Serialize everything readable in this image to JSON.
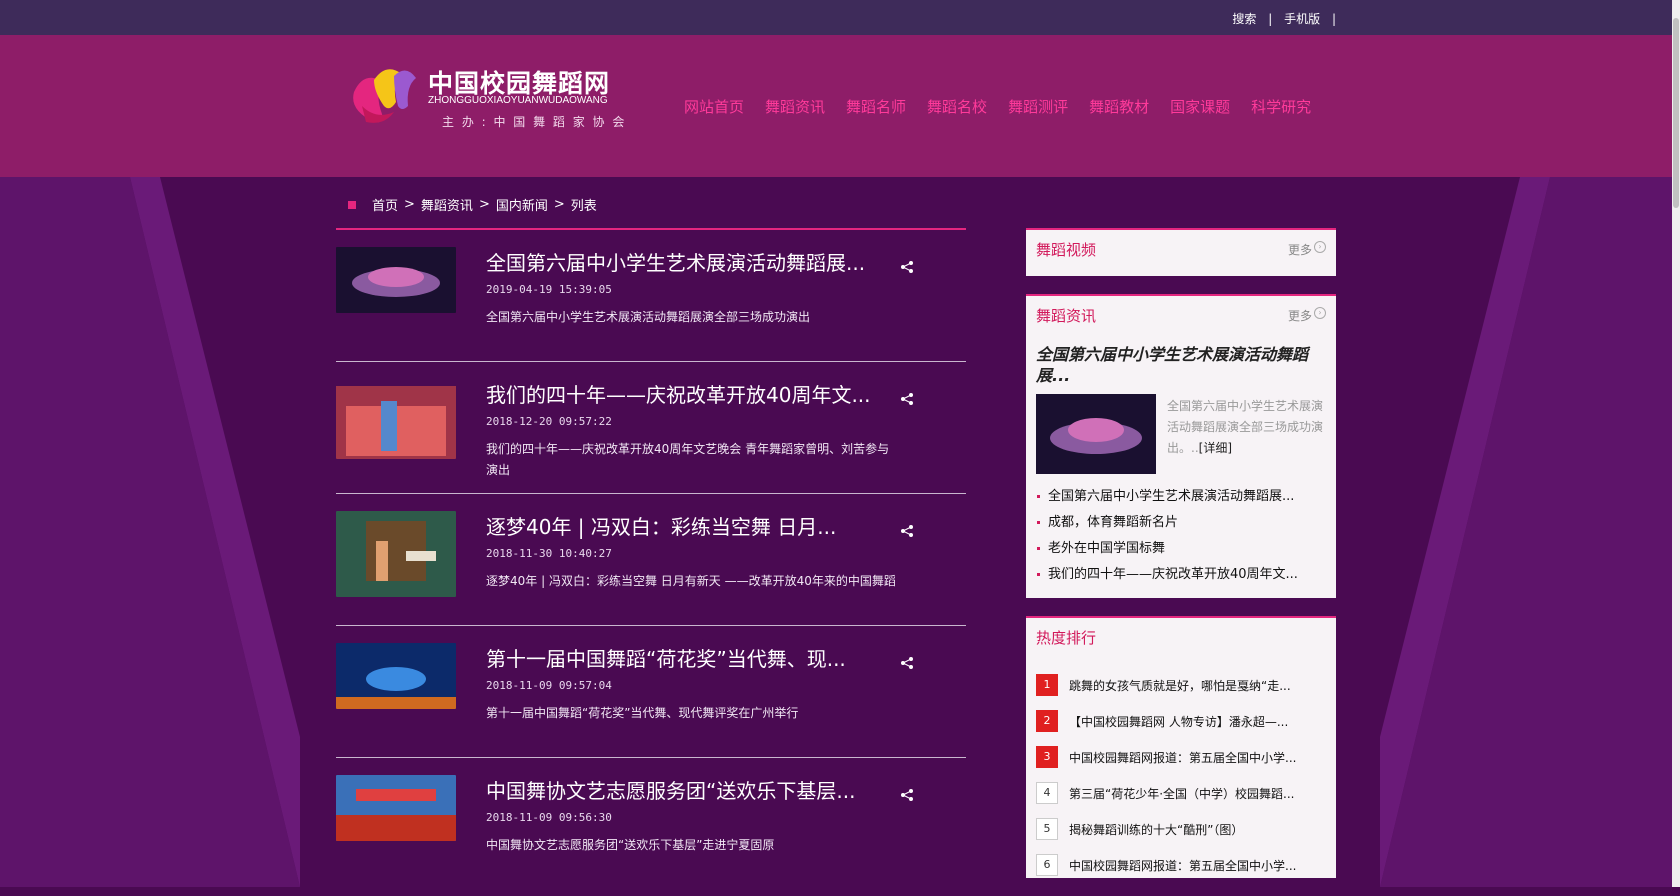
{
  "topbar": {
    "search": "搜索",
    "mobile": "手机版",
    "divider": "|"
  },
  "logo": {
    "title": "中国校园舞蹈网",
    "pinyin": "ZHONGGUOXIAOYUANWUDAOWANG",
    "host": "主 办 : 中 国 舞 蹈 家 协 会"
  },
  "nav": [
    "网站首页",
    "舞蹈资讯",
    "舞蹈名师",
    "舞蹈名校",
    "舞蹈测评",
    "舞蹈教材",
    "国家课题",
    "科学研究"
  ],
  "breadcrumb": {
    "home": "首页",
    "c1": "舞蹈资讯",
    "c2": "国内新闻",
    "c3": "列表",
    "sep": ">"
  },
  "articles": [
    {
      "title": "全国第六届中小学生艺术展演活动舞蹈展...",
      "date": "2019-04-19 15:39:05",
      "desc": "全国第六届中小学生艺术展演活动舞蹈展演全部三场成功演出",
      "thumb_color": "#1a1030"
    },
    {
      "title": "我们的四十年——庆祝改革开放40周年文...",
      "date": "2018-12-20 09:57:22",
      "desc": "我们的四十年——庆祝改革开放40周年文艺晚会 青年舞蹈家曾明、刘苦参与演出",
      "thumb_color": "#a03448"
    },
    {
      "title": "逐梦40年 | 冯双白：彩练当空舞 日月...",
      "date": "2018-11-30 10:40:27",
      "desc": "逐梦40年 | 冯双白：彩练当空舞 日月有新天 ——改革开放40年来的中国舞蹈",
      "thumb_color": "#2e5a4a"
    },
    {
      "title": "第十一届中国舞蹈“荷花奖”当代舞、现...",
      "date": "2018-11-09 09:57:04",
      "desc": "第十一届中国舞蹈“荷花奖”当代舞、现代舞评奖在广州举行",
      "thumb_color": "#0c2a6a"
    },
    {
      "title": "中国舞协文艺志愿服务团“送欢乐下基层...",
      "date": "2018-11-09 09:56:30",
      "desc": "中国舞协文艺志愿服务团“送欢乐下基层”走进宁夏固原",
      "thumb_color": "#3a70b8"
    }
  ],
  "sidebar": {
    "video_panel": {
      "title": "舞蹈视频",
      "more": "更多"
    },
    "news_panel": {
      "title": "舞蹈资讯",
      "more": "更多",
      "featured_title": "全国第六届中小学生艺术展演活动舞蹈展...",
      "featured_desc": "全国第六届中小学生艺术展演活动舞蹈展演全部三场成功演出。..",
      "featured_detail": "[详细]",
      "items": [
        "全国第六届中小学生艺术展演活动舞蹈展...",
        "成都，体育舞蹈新名片",
        "老外在中国学国标舞",
        "我们的四十年——庆祝改革开放40周年文..."
      ]
    },
    "rank_panel": {
      "title": "热度排行",
      "items": [
        {
          "n": "1",
          "text": "跳舞的女孩气质就是好，哪怕是戛纳“走..."
        },
        {
          "n": "2",
          "text": "【中国校园舞蹈网 人物专访】潘永超—..."
        },
        {
          "n": "3",
          "text": "中国校园舞蹈网报道：第五届全国中小学..."
        },
        {
          "n": "4",
          "text": "第三届“荷花少年·全国（中学）校园舞蹈..."
        },
        {
          "n": "5",
          "text": "揭秘舞蹈训练的十大“酷刑”（图）"
        },
        {
          "n": "6",
          "text": "中国校园舞蹈网报道：第五届全国中小学..."
        }
      ]
    }
  },
  "colors": {
    "accent": "#e4267f",
    "nav_link": "#ff3a9a",
    "header": "#8e1d68",
    "topbar": "#3e2b5a",
    "rank_hot": "#e02020"
  }
}
